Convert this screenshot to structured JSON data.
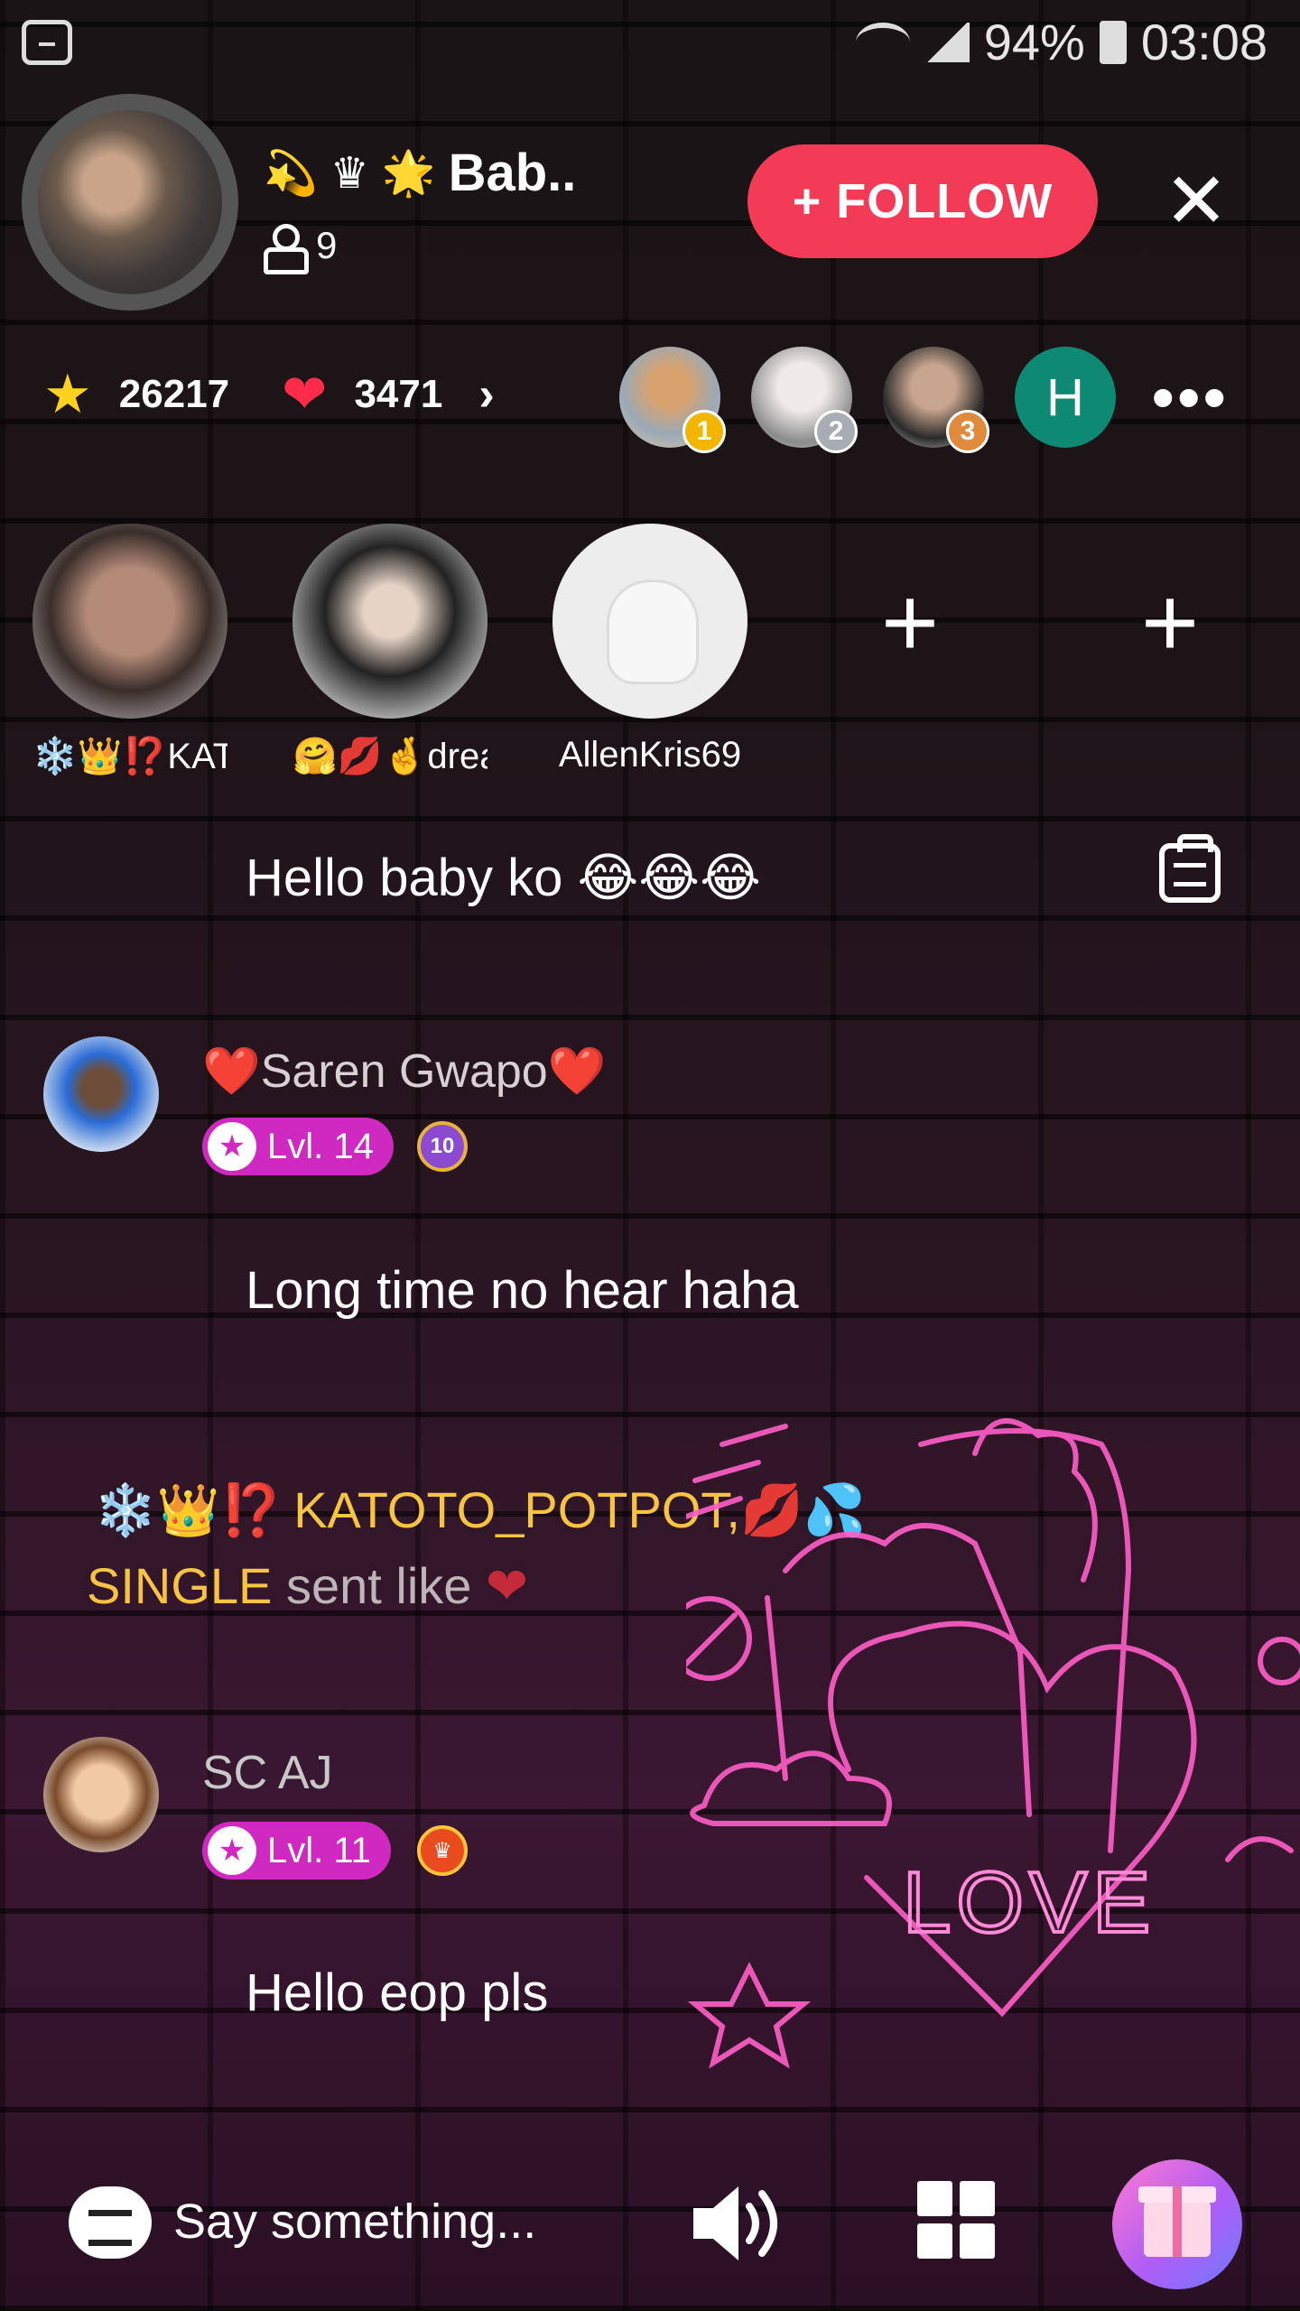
{
  "status_bar": {
    "battery": "94%",
    "time": "03:08"
  },
  "host": {
    "name": "Bab..",
    "name_badges": [
      "💫",
      "♛",
      "🌟"
    ],
    "viewer_count": "9",
    "follow_label": "+ FOLLOW",
    "close_glyph": "✕"
  },
  "stats": {
    "stars": "26217",
    "likes": "3471"
  },
  "top_fans": [
    {
      "rank": "1"
    },
    {
      "rank": "2"
    },
    {
      "rank": "3"
    },
    {
      "initial": "H"
    }
  ],
  "seats": [
    {
      "name": "❄️👑⁉️KAT..."
    },
    {
      "name": "🤗💋🤞drea..."
    },
    {
      "name": "AllenKris69"
    }
  ],
  "chat": {
    "host_message": "Hello baby ko 😂😂😂",
    "messages": [
      {
        "user": "❤️Saren Gwapo❤️",
        "level": "Lvl. 14",
        "medal": "10",
        "text": "Long time no hear haha"
      },
      {
        "user": "SC AJ",
        "level": "Lvl. 11",
        "medal": "",
        "text": "Hello eop pls"
      }
    ],
    "like_event": {
      "prefix_icons": "❄️👑⁉️",
      "user_part1": "KATOTO_POTPOT,💋💦",
      "user_part2": "SINGLE",
      "action": "sent like",
      "heart": "❤"
    }
  },
  "neon_sign": {
    "text": "LOVE"
  },
  "bottom_bar": {
    "input_placeholder": "Say something..."
  },
  "colors": {
    "follow": "#f33a56",
    "level_badge": "#cf29c2",
    "gold_text": "#f6c343",
    "neon_pink": "#ff5fc8"
  }
}
